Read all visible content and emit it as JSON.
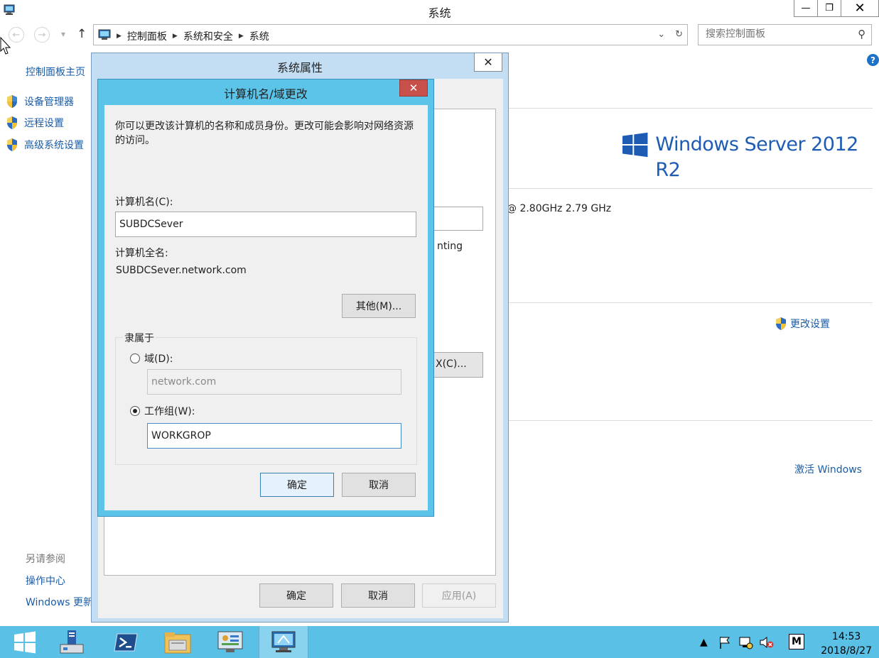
{
  "window": {
    "title": "系统",
    "minimize": "—",
    "restore": "❐",
    "close": "✕"
  },
  "address_bar": {
    "crumbs": [
      "控制面板",
      "系统和安全",
      "系统"
    ],
    "dropdown": "⌄",
    "refresh": "↻"
  },
  "search": {
    "placeholder": "搜索控制面板"
  },
  "sidebar": {
    "home": "控制面板主页",
    "items": [
      {
        "label": "设备管理器"
      },
      {
        "label": "远程设置"
      },
      {
        "label": "高级系统设置"
      }
    ],
    "see_also": "另请参阅",
    "links": [
      {
        "label": "操作中心"
      },
      {
        "label": "Windows 更新"
      }
    ]
  },
  "content": {
    "brand": "Windows Server 2012 R2",
    "cpu_text": "@ 2.80GHz   2.79 GHz",
    "change_settings": "更改设置",
    "activate": "激活 Windows"
  },
  "system_properties": {
    "title": "系统属性",
    "close": "✕",
    "partial_text": "nting",
    "partial_button": "X(C)...",
    "ok": "确定",
    "cancel": "取消",
    "apply": "应用(A)"
  },
  "computer_name_dialog": {
    "title": "计算机名/域更改",
    "close": "✕",
    "description": "你可以更改该计算机的名称和成员身份。更改可能会影响对网络资源的访问。",
    "computer_name_label": "计算机名(C):",
    "computer_name_value": "SUBDCSever",
    "full_name_label": "计算机全名:",
    "full_name_value": "SUBDCSever.network.com",
    "more_button": "其他(M)...",
    "member_of_label": "隶属于",
    "domain_label": "域(D):",
    "domain_value": "network.com",
    "workgroup_label": "工作组(W):",
    "workgroup_value": "WORKGROP",
    "selected": "workgroup",
    "ok": "确定",
    "cancel": "取消"
  },
  "taskbar": {
    "items": [
      "start",
      "server-manager",
      "powershell",
      "file-explorer",
      "control-panel",
      "system"
    ],
    "active": "system",
    "ime": "M",
    "time": "14:53",
    "date": "2018/8/27"
  },
  "colors": {
    "link": "#1a5ca8",
    "taskbar": "#5bc0e6",
    "dialog_frame": "#5bc4e8",
    "close_red": "#c7504a"
  }
}
